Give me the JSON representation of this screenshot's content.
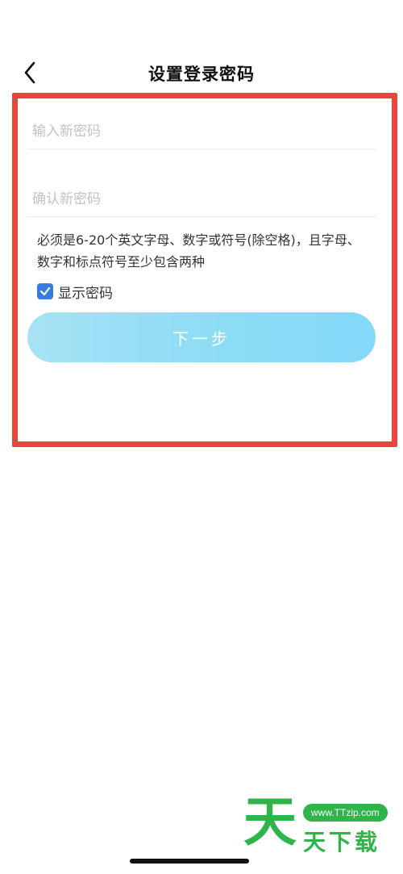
{
  "header": {
    "back_icon": "chevron-left-icon",
    "title": "设置登录密码"
  },
  "form": {
    "new_password": {
      "value": "",
      "placeholder": "输入新密码"
    },
    "confirm_password": {
      "value": "",
      "placeholder": "确认新密码"
    },
    "hint": "必须是6-20个英文字母、数字或符号(除空格)，且字母、数字和标点符号至少包含两种",
    "show_password": {
      "label": "显示密码",
      "checked": true
    },
    "next_button": "下一步"
  },
  "highlight_color": "#e5473f",
  "accent_color": "#3a7be0",
  "watermark": {
    "big_char": "天",
    "url": "www.TTzip.com",
    "text": "天下载"
  }
}
